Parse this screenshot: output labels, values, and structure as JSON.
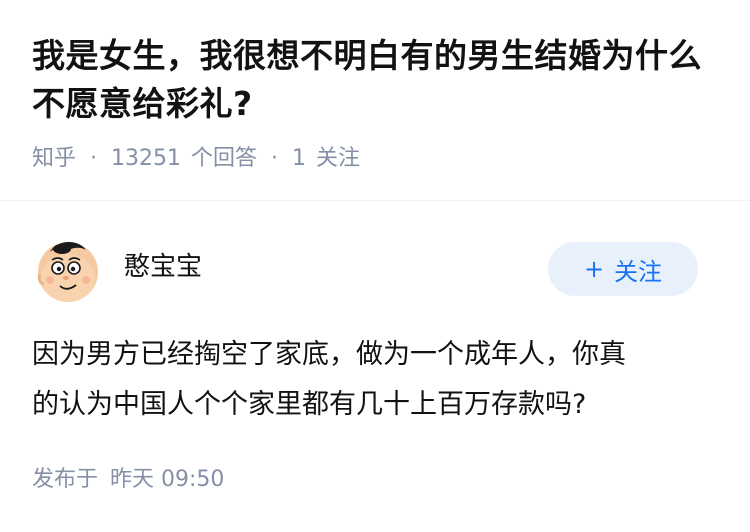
{
  "question": {
    "title": "我是女生，我很想不明白有的男生结婚为什么不愿意给彩礼?",
    "source": "知乎",
    "separator": "·",
    "answer_count": "13251",
    "answer_label": "个回答",
    "follow_count": "1",
    "follow_label": "关注"
  },
  "answer": {
    "author_name": "憨宝宝",
    "follow_button_label": "关注",
    "follow_button_icon": "plus-icon",
    "content_lines": [
      "因为男方已经掏空了家底，做为一个成年人，你真",
      "的认为中国人个个家里都有几十上百万存款吗?"
    ],
    "publish_label": "发布于",
    "publish_time": "昨天 09:50"
  },
  "colors": {
    "title": "#121212",
    "meta": "#8590a6",
    "accent": "#1772f6",
    "follow_bg": "#e8f1fb",
    "divider": "#f0f2f7"
  }
}
